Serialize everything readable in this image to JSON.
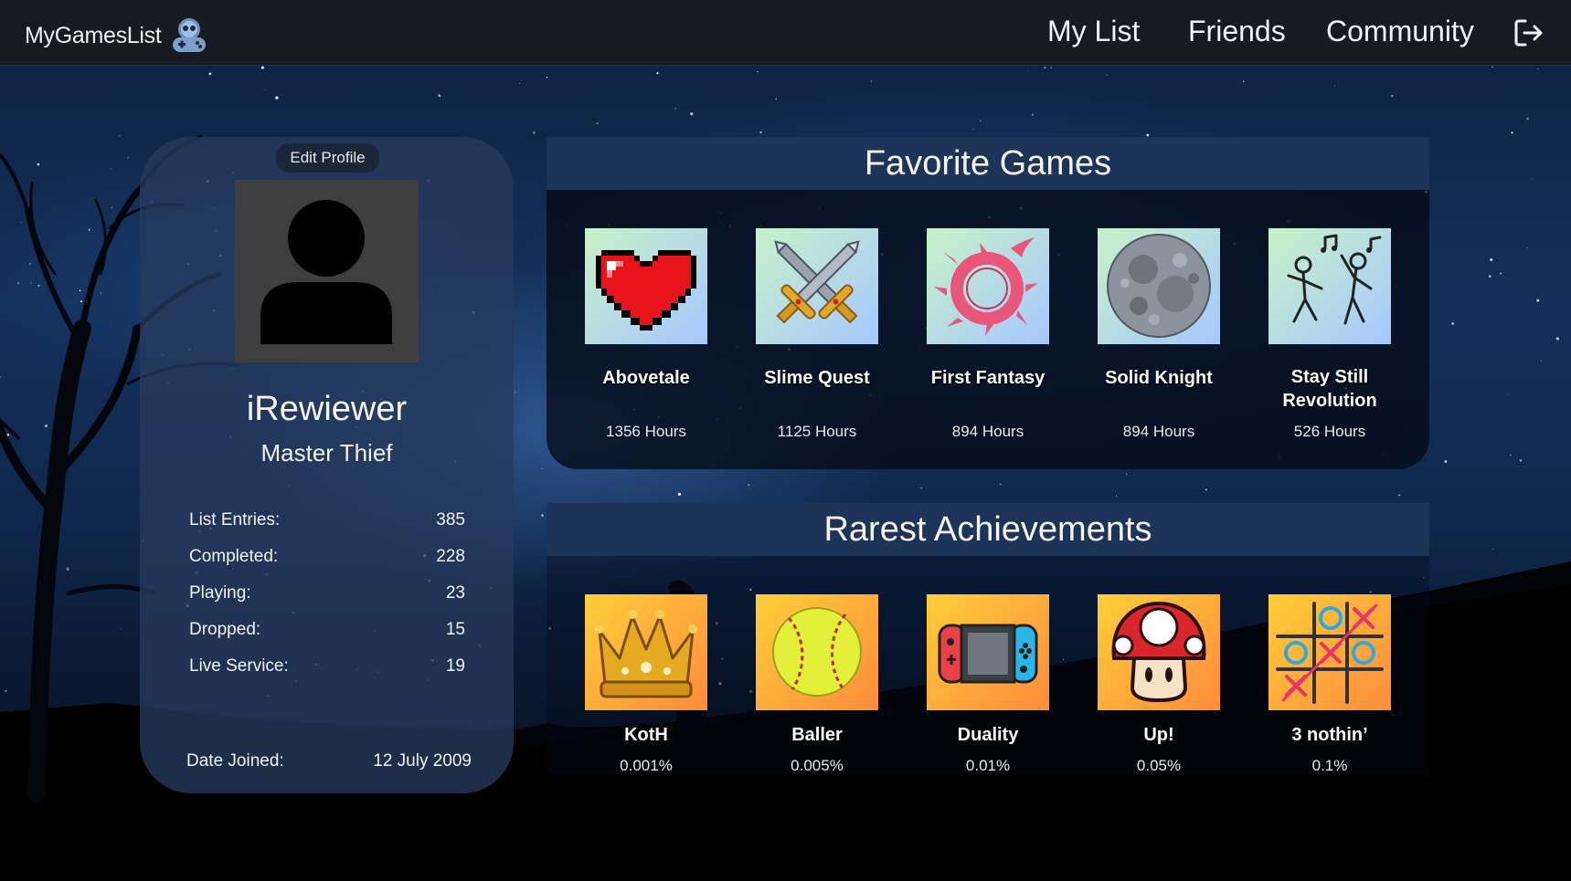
{
  "app": {
    "name": "MyGamesList"
  },
  "nav": {
    "my_list": "My List",
    "friends": "Friends",
    "community": "Community"
  },
  "profile": {
    "edit_label": "Edit Profile",
    "username": "iRewiewer",
    "title": "Master Thief",
    "stats": [
      {
        "label": "List Entries:",
        "value": "385"
      },
      {
        "label": "Completed:",
        "value": "228"
      },
      {
        "label": "Playing:",
        "value": "23"
      },
      {
        "label": "Dropped:",
        "value": "15"
      },
      {
        "label": "Live Service:",
        "value": "19"
      }
    ],
    "joined_label": "Date Joined:",
    "joined_value": "12 July 2009"
  },
  "favorites": {
    "heading": "Favorite Games",
    "games": [
      {
        "name": "Abovetale",
        "hours": "1356 Hours",
        "icon": "pixel-heart-icon"
      },
      {
        "name": "Slime Quest",
        "hours": "1125 Hours",
        "icon": "crossed-swords-icon"
      },
      {
        "name": "First Fantasy",
        "hours": "894 Hours",
        "icon": "flame-ring-icon"
      },
      {
        "name": "Solid Knight",
        "hours": "894 Hours",
        "icon": "moon-icon"
      },
      {
        "name": "Stay Still Revolution",
        "hours": "526 Hours",
        "icon": "dancers-icon"
      }
    ]
  },
  "achievements": {
    "heading": "Rarest Achievements",
    "items": [
      {
        "name": "KotH",
        "rate": "0.001%",
        "icon": "crown-icon"
      },
      {
        "name": "Baller",
        "rate": "0.005%",
        "icon": "softball-icon"
      },
      {
        "name": "Duality",
        "rate": "0.01%",
        "icon": "handheld-console-icon"
      },
      {
        "name": "Up!",
        "rate": "0.05%",
        "icon": "mushroom-icon"
      },
      {
        "name": "3 nothin’",
        "rate": "0.1%",
        "icon": "tic-tac-toe-icon"
      }
    ]
  },
  "colors": {
    "topbar": "#171b21",
    "panel_header": "#1d3357",
    "fav_tile_start": "#c7f2c8",
    "fav_tile_end": "#a6c7ff",
    "ach_tile_start": "#ffce3a",
    "ach_tile_end": "#ff8b3c"
  }
}
